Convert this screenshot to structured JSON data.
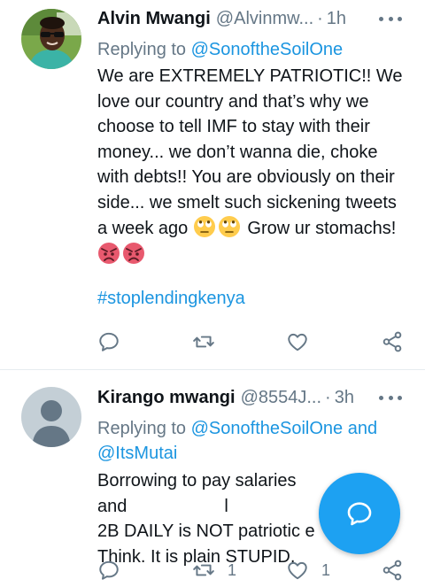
{
  "tweets": [
    {
      "display_name": "Alvin Mwangi",
      "handle": "@Alvinmw...",
      "separator": "·",
      "time": "1h",
      "replying_prefix": "Replying to",
      "replying_mentions": [
        "@SonoftheSoilOne"
      ],
      "replying_joiner": "",
      "body_main": "We are EXTREMELY PATRIOTIC!! We love our country and that’s why we choose to tell IMF to stay with their money... we don’t wanna die, choke with debts!! You are obviously on their side... we smelt such sickening tweets a week ago",
      "body_after_emoji": "Grow ur stomachs!",
      "emojis_1": [
        "face-with-rolling-eyes",
        "face-with-rolling-eyes"
      ],
      "emojis_2": [
        "angry-face",
        "angry-face"
      ],
      "hashtag": "#stoplendingkenya",
      "counts": {
        "reply": "",
        "retweet": "",
        "like": ""
      }
    },
    {
      "display_name": "Kirango mwangi",
      "handle": "@8554J...",
      "separator": "·",
      "time": "3h",
      "replying_prefix": "Replying to",
      "replying_mentions": [
        "@SonoftheSoilOne",
        "@ItsMutai"
      ],
      "replying_joiner": "and",
      "body_line_1": "Borrowing to pay salaries and",
      "body_line_1_tail": "l",
      "body_line_2": "2B DAILY is NOT patriotic e",
      "body_line_3": "Think. It is plain STUPID.",
      "counts": {
        "reply": "",
        "retweet": "1",
        "like": "1"
      }
    }
  ],
  "icons": {
    "more": "more-horizontal-icon",
    "reply": "reply-bubble-icon",
    "retweet": "retweet-icon",
    "like": "heart-icon",
    "share": "share-icon",
    "compose": "compose-reply-icon"
  },
  "colors": {
    "accent": "#1da1f2",
    "link": "#1b95e0",
    "muted": "#657786",
    "text": "#0f1419",
    "divider": "#e6ecf0"
  }
}
